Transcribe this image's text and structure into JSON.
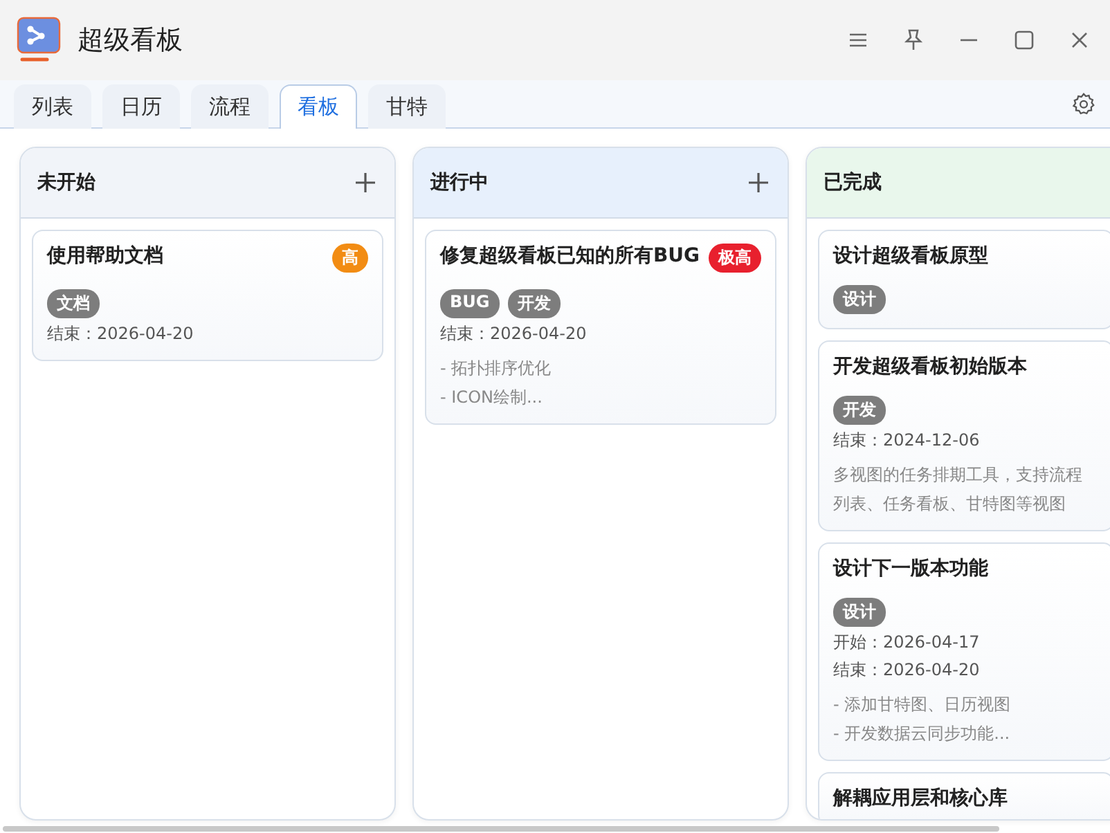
{
  "window": {
    "title": "超级看板"
  },
  "tabs": [
    {
      "label": "列表",
      "selected": false
    },
    {
      "label": "日历",
      "selected": false
    },
    {
      "label": "流程",
      "selected": false
    },
    {
      "label": "看板",
      "selected": true
    },
    {
      "label": "甘特",
      "selected": false
    }
  ],
  "columns": [
    {
      "title": "未开始",
      "color": "#f1f4f9",
      "add_button": true,
      "cards": [
        {
          "title": "使用帮助文档",
          "priority": {
            "label": "高",
            "color": "#f28c13"
          },
          "tags": [
            "文档"
          ],
          "dates": [
            "结束：2026-04-20"
          ]
        }
      ]
    },
    {
      "title": "进行中",
      "color": "#e7f0fc",
      "add_button": true,
      "cards": [
        {
          "title": "修复超级看板已知的所有BUG",
          "priority": {
            "label": "极高",
            "color": "#e8202e"
          },
          "tags": [
            "BUG",
            "开发"
          ],
          "dates": [
            "结束：2026-04-20"
          ],
          "notes": [
            "- 拓扑排序优化",
            "- ICON绘制..."
          ]
        }
      ]
    },
    {
      "title": "已完成",
      "color": "#e9f7ec",
      "add_button": false,
      "cards": [
        {
          "title": "设计超级看板原型",
          "tags": [
            "设计"
          ]
        },
        {
          "title": "开发超级看板初始版本",
          "tags": [
            "开发"
          ],
          "dates": [
            "结束：2024-12-06"
          ],
          "notes": [
            "多视图的任务排期工具，支持流程",
            "列表、任务看板、甘特图等视图"
          ]
        },
        {
          "title": "设计下一版本功能",
          "tags": [
            "设计"
          ],
          "dates": [
            "开始：2026-04-17",
            "结束：2026-04-20"
          ],
          "notes": [
            "- 添加甘特图、日历视图",
            "- 开发数据云同步功能..."
          ]
        },
        {
          "title": "解耦应用层和核心库"
        }
      ]
    }
  ]
}
